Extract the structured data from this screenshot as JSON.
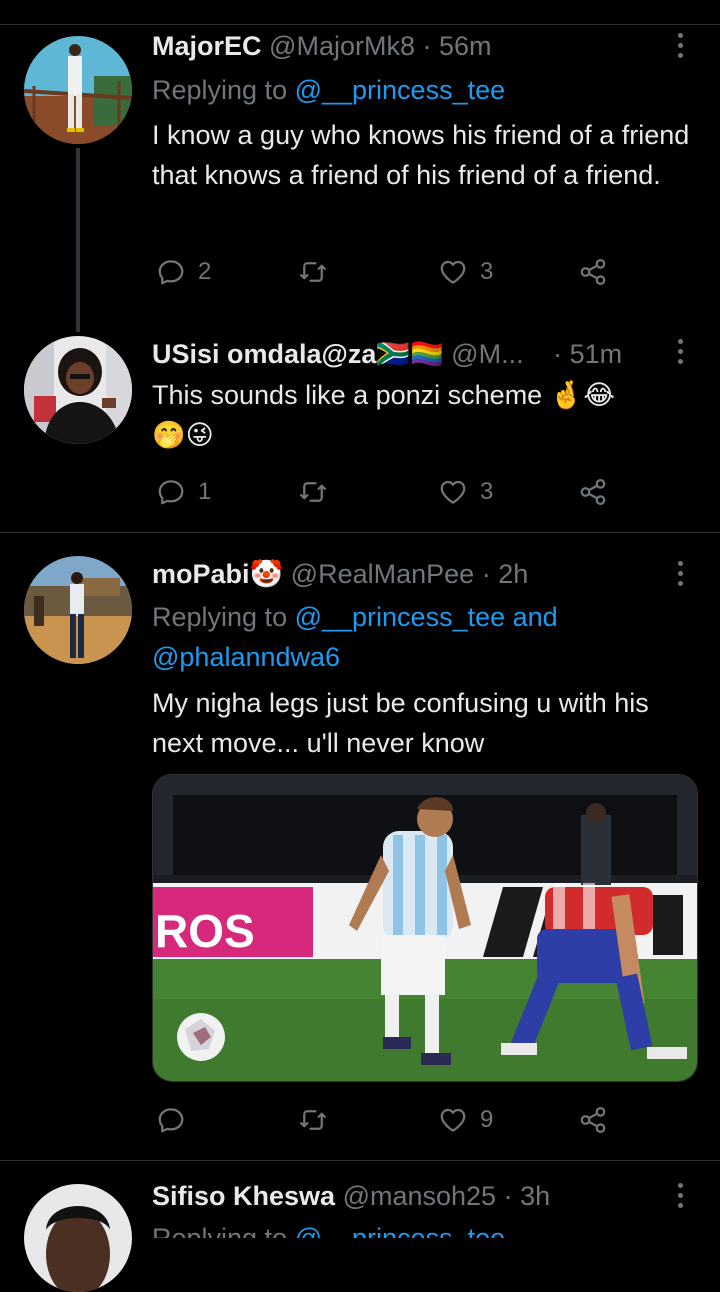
{
  "tweets": [
    {
      "name": "MajorEC",
      "name_emoji": "",
      "handle": "@MajorMk8",
      "dot": "·",
      "time": "56m",
      "replying_prefix": "Replying to ",
      "replying_to": "@__princess_tee",
      "replying_extra": "",
      "replying_to2": "",
      "text": "I know a guy who knows his friend of a friend that knows a friend of his friend of a friend.",
      "replies": "2",
      "retweets": "",
      "likes": "3"
    },
    {
      "name": "USisi omdala@za",
      "name_emoji": "🇿🇦🏳️‍🌈",
      "handle": "@M...",
      "dot": "·",
      "time": "51m",
      "text": "This sounds like a ponzi scheme 🤞😂",
      "text_line2": "🤭😜",
      "replies": "1",
      "retweets": "",
      "likes": "3"
    },
    {
      "name": "moPabi",
      "name_emoji": "🤡",
      "handle": "@RealManPee",
      "dot": "·",
      "time": "2h",
      "replying_prefix": "Replying to ",
      "replying_to": "@__princess_tee",
      "replying_extra": " and",
      "replying_to2": "@phalanndwa6",
      "text": "My nigha legs  just be confusing u with his next move... u'll never know",
      "media_text": "ROS",
      "replies": "",
      "retweets": "",
      "likes": "9"
    },
    {
      "name": "Sifiso Kheswa",
      "handle": "@mansoh25",
      "dot": "·",
      "time": "3h",
      "replying_prefix": "Replying to ",
      "replying_to": "@__princess_tee"
    }
  ],
  "icons": [
    "reply-icon",
    "retweet-icon",
    "like-icon",
    "share-icon",
    "more-icon"
  ],
  "colors": {
    "background": "#000000",
    "text": "#e7e9ea",
    "secondary": "#71767b",
    "link": "#1d9bf0",
    "divider": "#2f3336"
  }
}
